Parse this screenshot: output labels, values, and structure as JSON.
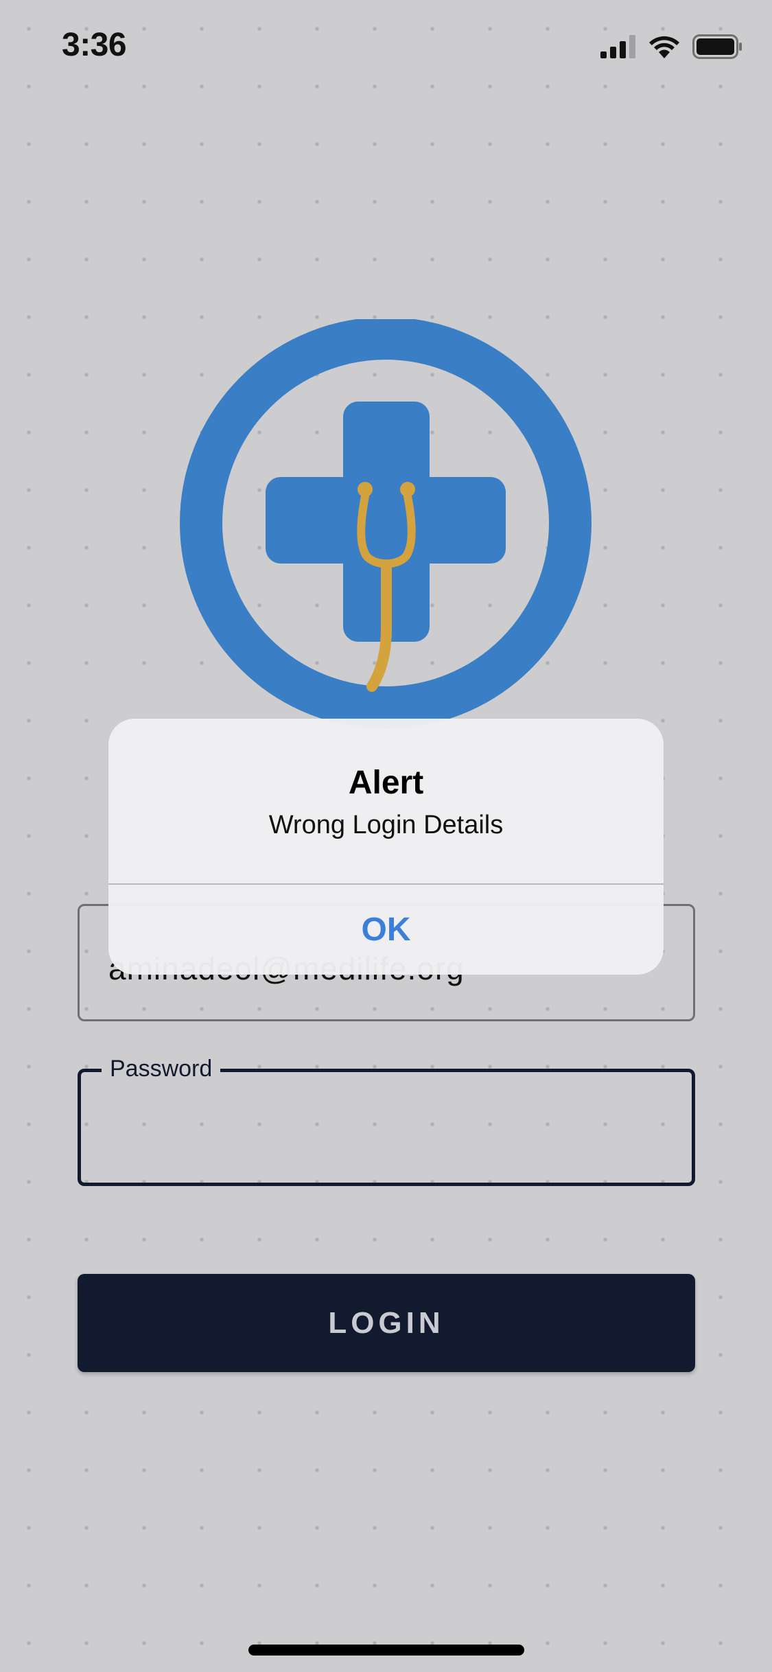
{
  "status_bar": {
    "time": "3:36",
    "icons": [
      "cellular-signal-icon",
      "wifi-icon",
      "battery-icon"
    ]
  },
  "logo": {
    "icon": "medical-cross-stethoscope-icon",
    "colors": {
      "primary": "#3a7fc5",
      "accent": "#d4a33e"
    }
  },
  "form": {
    "email": {
      "legend": "",
      "value": "aminadeol@medilife.org"
    },
    "password": {
      "legend": "Password",
      "value": ""
    },
    "login_label": "LOGIN"
  },
  "alert": {
    "title": "Alert",
    "message": "Wrong Login Details",
    "ok_label": "OK",
    "ok_color": "#3b7fdb"
  }
}
